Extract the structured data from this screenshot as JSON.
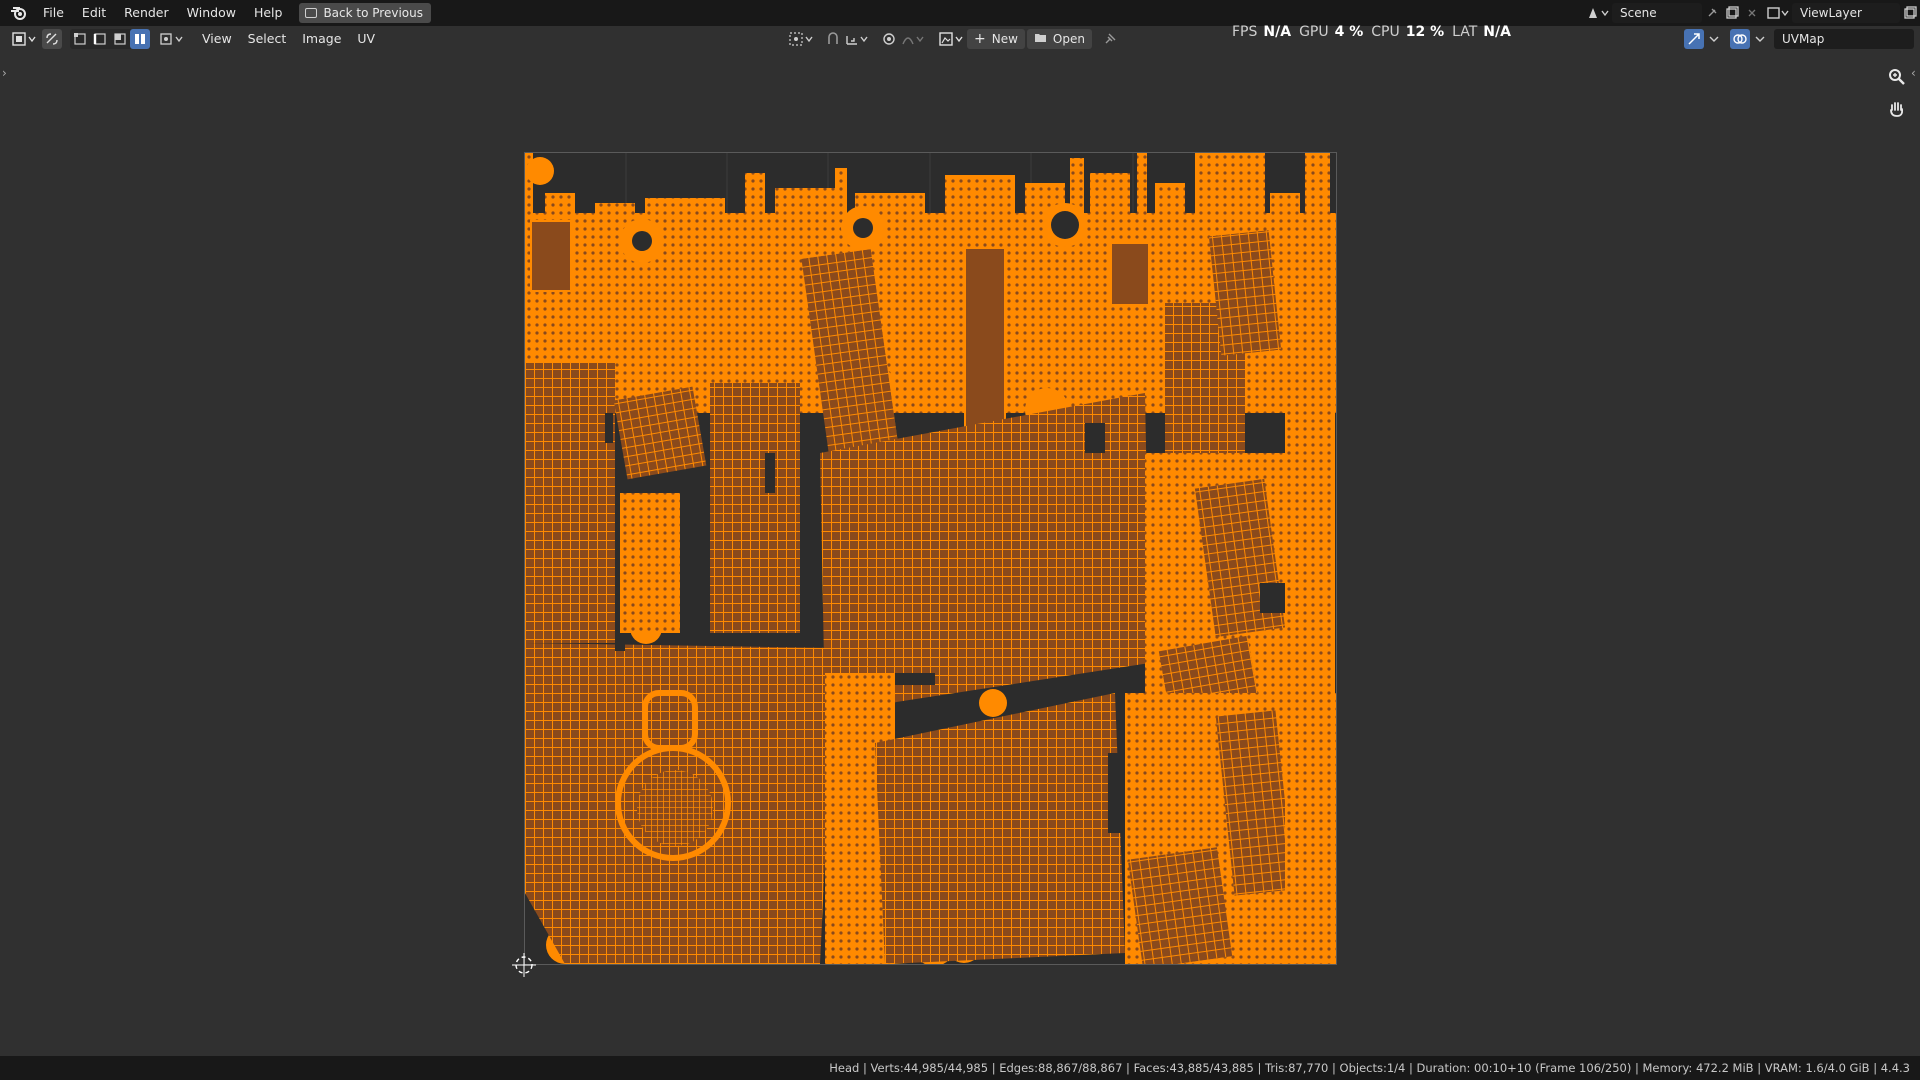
{
  "app": {
    "name": "Blender"
  },
  "topbar": {
    "menu": [
      "File",
      "Edit",
      "Render",
      "Window",
      "Help"
    ],
    "back_button": "Back to Previous",
    "scene_label": "Scene",
    "viewlayer_label": "ViewLayer"
  },
  "perf": {
    "fps_label": "FPS",
    "fps_value": "N/A",
    "gpu_label": "GPU",
    "gpu_value": "4 %",
    "cpu_label": "CPU",
    "cpu_value": "12 %",
    "lat_label": "LAT",
    "lat_value": "N/A"
  },
  "editor_header": {
    "menus": [
      "View",
      "Select",
      "Image",
      "UV"
    ],
    "new_button": "New",
    "open_button": "Open",
    "uvmap": "UVMap"
  },
  "statusbar": {
    "text": "Head | Verts:44,985/44,985 | Edges:88,867/88,867 | Faces:43,885/43,885 | Tris:87,770 | Objects:1/4 | Duration: 00:10+10 (Frame 106/250) | Memory: 472.2 MiB | VRAM: 1.6/4.0 GiB | 4.4.3"
  },
  "colors": {
    "uv_orange": "#ff8a00",
    "uv_face": "#8a4a1c",
    "background": "#303030",
    "topbar": "#181818"
  },
  "icons": [
    "blender-logo-icon",
    "back-icon",
    "editor-type-icon",
    "uv-sync-icon",
    "select-mode-icons",
    "pivot-icon",
    "snap-icon",
    "proportional-icon",
    "image-icon",
    "new-icon",
    "open-icon",
    "pin-icon",
    "gizmo-icon",
    "overlay-icon",
    "zoom-icon",
    "pan-hand-icon",
    "cursor-2d-icon"
  ]
}
